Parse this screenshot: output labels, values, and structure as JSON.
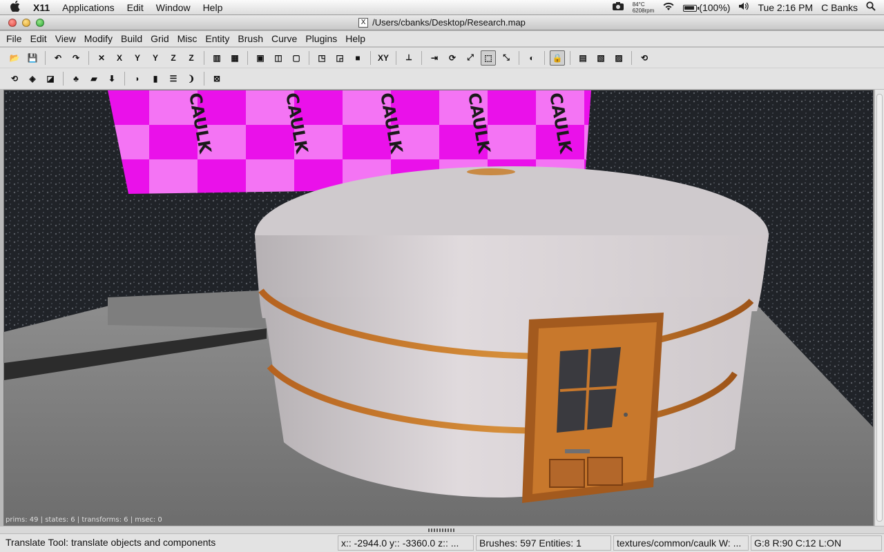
{
  "menubar": {
    "apple": "",
    "app_name": "X11",
    "items": [
      "Applications",
      "Edit",
      "Window",
      "Help"
    ],
    "temp": "84°C",
    "rpm": "6208rpm",
    "battery": "(100%)",
    "clock": "Tue 2:16 PM",
    "user": "C Banks"
  },
  "window": {
    "title": "/Users/cbanks/Desktop/Research.map"
  },
  "app_menu": [
    "File",
    "Edit",
    "View",
    "Modify",
    "Build",
    "Grid",
    "Misc",
    "Entity",
    "Brush",
    "Curve",
    "Plugins",
    "Help"
  ],
  "toolbar1": [
    {
      "icon": "open-icon",
      "glyph": "📂"
    },
    {
      "icon": "save-icon",
      "glyph": "💾"
    },
    {
      "sep": true
    },
    {
      "icon": "undo-icon",
      "glyph": "↶"
    },
    {
      "icon": "redo-icon",
      "glyph": "↷"
    },
    {
      "sep": true
    },
    {
      "icon": "flip-x-icon",
      "glyph": "✕"
    },
    {
      "icon": "rotate-x-icon",
      "glyph": "X"
    },
    {
      "icon": "flip-y-icon",
      "glyph": "Y"
    },
    {
      "icon": "rotate-y-icon",
      "glyph": "Y"
    },
    {
      "icon": "flip-z-icon",
      "glyph": "Z"
    },
    {
      "icon": "rotate-z-icon",
      "glyph": "Z"
    },
    {
      "sep": true
    },
    {
      "icon": "select-complete-tall-icon",
      "glyph": "▥"
    },
    {
      "icon": "select-touching-icon",
      "glyph": "▦"
    },
    {
      "sep": true
    },
    {
      "icon": "view-change-icon",
      "glyph": "▣"
    },
    {
      "icon": "view-side-icon",
      "glyph": "◫"
    },
    {
      "icon": "view-front-icon",
      "glyph": "▢"
    },
    {
      "sep": true
    },
    {
      "icon": "csg-hollow-icon",
      "glyph": "◳"
    },
    {
      "icon": "csg-subtract-icon",
      "glyph": "◲"
    },
    {
      "icon": "csg-merge-icon",
      "glyph": "■"
    },
    {
      "sep": true
    },
    {
      "icon": "show-xy-icon",
      "glyph": "XY"
    },
    {
      "sep": true
    },
    {
      "icon": "clipper-icon",
      "glyph": "⟂"
    },
    {
      "sep": true
    },
    {
      "icon": "translate-icon",
      "glyph": "⇥"
    },
    {
      "icon": "rotate-icon",
      "glyph": "⟳"
    },
    {
      "icon": "scale-icon",
      "glyph": "⤢"
    },
    {
      "icon": "drag-icon",
      "glyph": "⬚",
      "active": true
    },
    {
      "icon": "resize-icon",
      "glyph": "⤡"
    },
    {
      "sep": true
    },
    {
      "icon": "texture-lock-icon",
      "glyph": "◐"
    },
    {
      "sep": true
    },
    {
      "icon": "lock-icon",
      "glyph": "🔒",
      "active": true
    },
    {
      "sep": true
    },
    {
      "icon": "patch-inspector-icon",
      "glyph": "▤"
    },
    {
      "icon": "surface-inspector-icon",
      "glyph": "▧"
    },
    {
      "icon": "texture-browser-icon",
      "glyph": "▨"
    },
    {
      "sep": true
    },
    {
      "icon": "refresh-icon",
      "glyph": "⟲"
    }
  ],
  "toolbar2": [
    {
      "icon": "plugin-refresh-icon",
      "glyph": "⟲"
    },
    {
      "icon": "plugin-cube-icon",
      "glyph": "◈"
    },
    {
      "icon": "plugin-texture-icon",
      "glyph": "◪"
    },
    {
      "sep": true
    },
    {
      "icon": "plugin-tree-icon",
      "glyph": "♣"
    },
    {
      "icon": "plugin-train-icon",
      "glyph": "▰"
    },
    {
      "icon": "plugin-arrow-down-icon",
      "glyph": "⬇"
    },
    {
      "sep": true
    },
    {
      "icon": "plugin-shield-icon",
      "glyph": "◗"
    },
    {
      "icon": "plugin-book-icon",
      "glyph": "▮"
    },
    {
      "icon": "plugin-stack-icon",
      "glyph": "☰"
    },
    {
      "icon": "plugin-brackets-icon",
      "glyph": "❩"
    },
    {
      "sep": true
    },
    {
      "icon": "plugin-portal-icon",
      "glyph": "⊠"
    }
  ],
  "viewport": {
    "stats": "prims: 49 | states: 6 | transforms: 6 | msec: 0",
    "caulk_label": "CAULK"
  },
  "statusbar": {
    "hint": "Translate Tool: translate objects and components",
    "coords": "x:: -2944.0  y:: -3360.0  z:: ...",
    "counts": "Brushes: 597 Entities: 1",
    "texture": "textures/common/caulk W: ...",
    "grid": "G:8  R:90  C:12  L:ON"
  }
}
